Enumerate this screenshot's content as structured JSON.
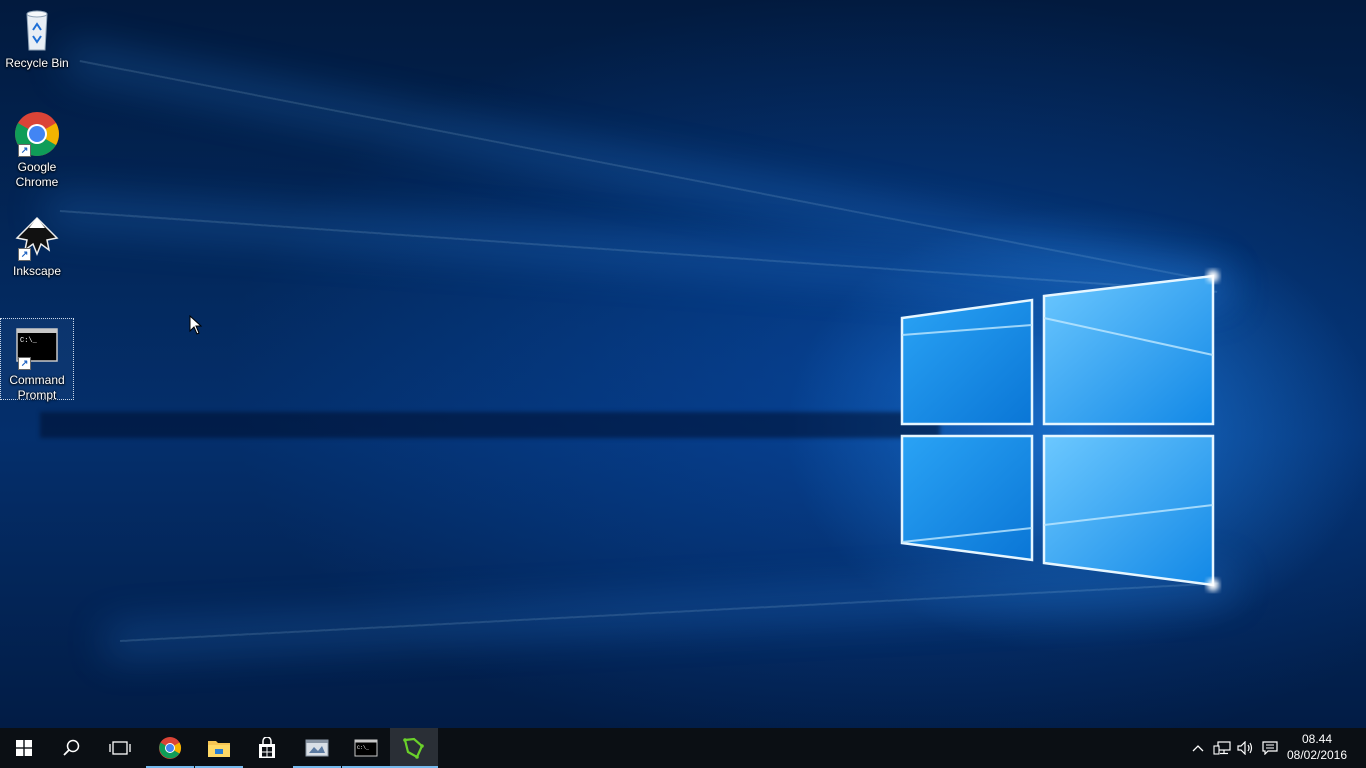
{
  "desktop": {
    "icons": [
      {
        "label": "Recycle Bin",
        "icon": "recycle-bin-icon"
      },
      {
        "label": "Google Chrome",
        "icon": "chrome-icon"
      },
      {
        "label": "Inkscape",
        "icon": "inkscape-icon"
      },
      {
        "label": "Command Prompt",
        "icon": "cmd-icon",
        "selected": true
      }
    ]
  },
  "taskbar": {
    "buttons": [
      {
        "name": "start",
        "icon": "windows-logo-icon"
      },
      {
        "name": "search",
        "icon": "search-icon"
      },
      {
        "name": "task-view",
        "icon": "task-view-icon"
      },
      {
        "name": "chrome",
        "icon": "chrome-icon",
        "running": true
      },
      {
        "name": "file-explorer",
        "icon": "folder-icon",
        "running": true
      },
      {
        "name": "store",
        "icon": "store-icon"
      },
      {
        "name": "app",
        "icon": "app-window-icon",
        "running": true
      },
      {
        "name": "command-prompt",
        "icon": "cmd-icon",
        "running": true
      },
      {
        "name": "inkscape-app",
        "icon": "green-app-icon",
        "running": true
      }
    ],
    "tray": {
      "icons": [
        "chevron-up-icon",
        "network-icon",
        "volume-icon",
        "action-center-icon"
      ],
      "time": "08.44",
      "date": "08/02/2016"
    }
  },
  "colors": {
    "taskbar": "#0b0f14",
    "active_indicator": "#76b9ed",
    "wallpaper_dark": "#021a3e",
    "wallpaper_glow": "#2896ff"
  }
}
